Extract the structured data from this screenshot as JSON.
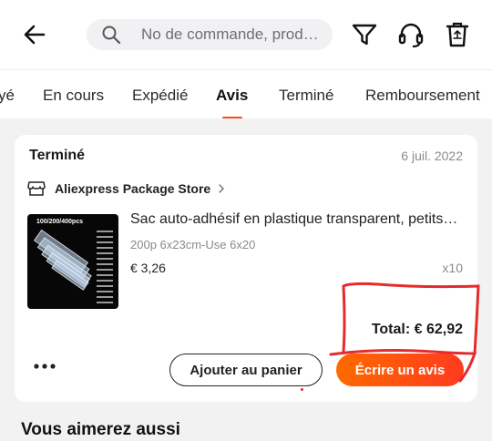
{
  "header": {
    "search_placeholder": "No de commande, prod…",
    "icons": [
      "back-arrow-icon",
      "search-icon",
      "filter-icon",
      "headset-icon",
      "trash-icon"
    ]
  },
  "tabs": [
    {
      "label": "yé",
      "active": false
    },
    {
      "label": "En cours",
      "active": false
    },
    {
      "label": "Expédié",
      "active": false
    },
    {
      "label": "Avis",
      "active": true
    },
    {
      "label": "Terminé",
      "active": false
    },
    {
      "label": "Remboursement",
      "active": false
    }
  ],
  "order": {
    "status": "Terminé",
    "date": "6 juil. 2022",
    "store": "Aliexpress Package Store",
    "thumbnail_label": "100/200/400pcs",
    "product_title": "Sac auto-adhésif en plastique transparent, petits…",
    "variant": "200p 6x23cm-Use 6x20",
    "price": "€ 3,26",
    "quantity": "x10",
    "total": "Total: € 62,92",
    "buttons": {
      "add_to_cart": "Ajouter au panier",
      "write_review": "Écrire un avis"
    }
  },
  "section_title": "Vous aimerez aussi",
  "colors": {
    "accent": "#ff4d1a",
    "button_gradient_start": "#ff6a00",
    "button_gradient_end": "#ff3b1f",
    "annotation": "#e52b2b",
    "background": "#f2f2f2"
  }
}
